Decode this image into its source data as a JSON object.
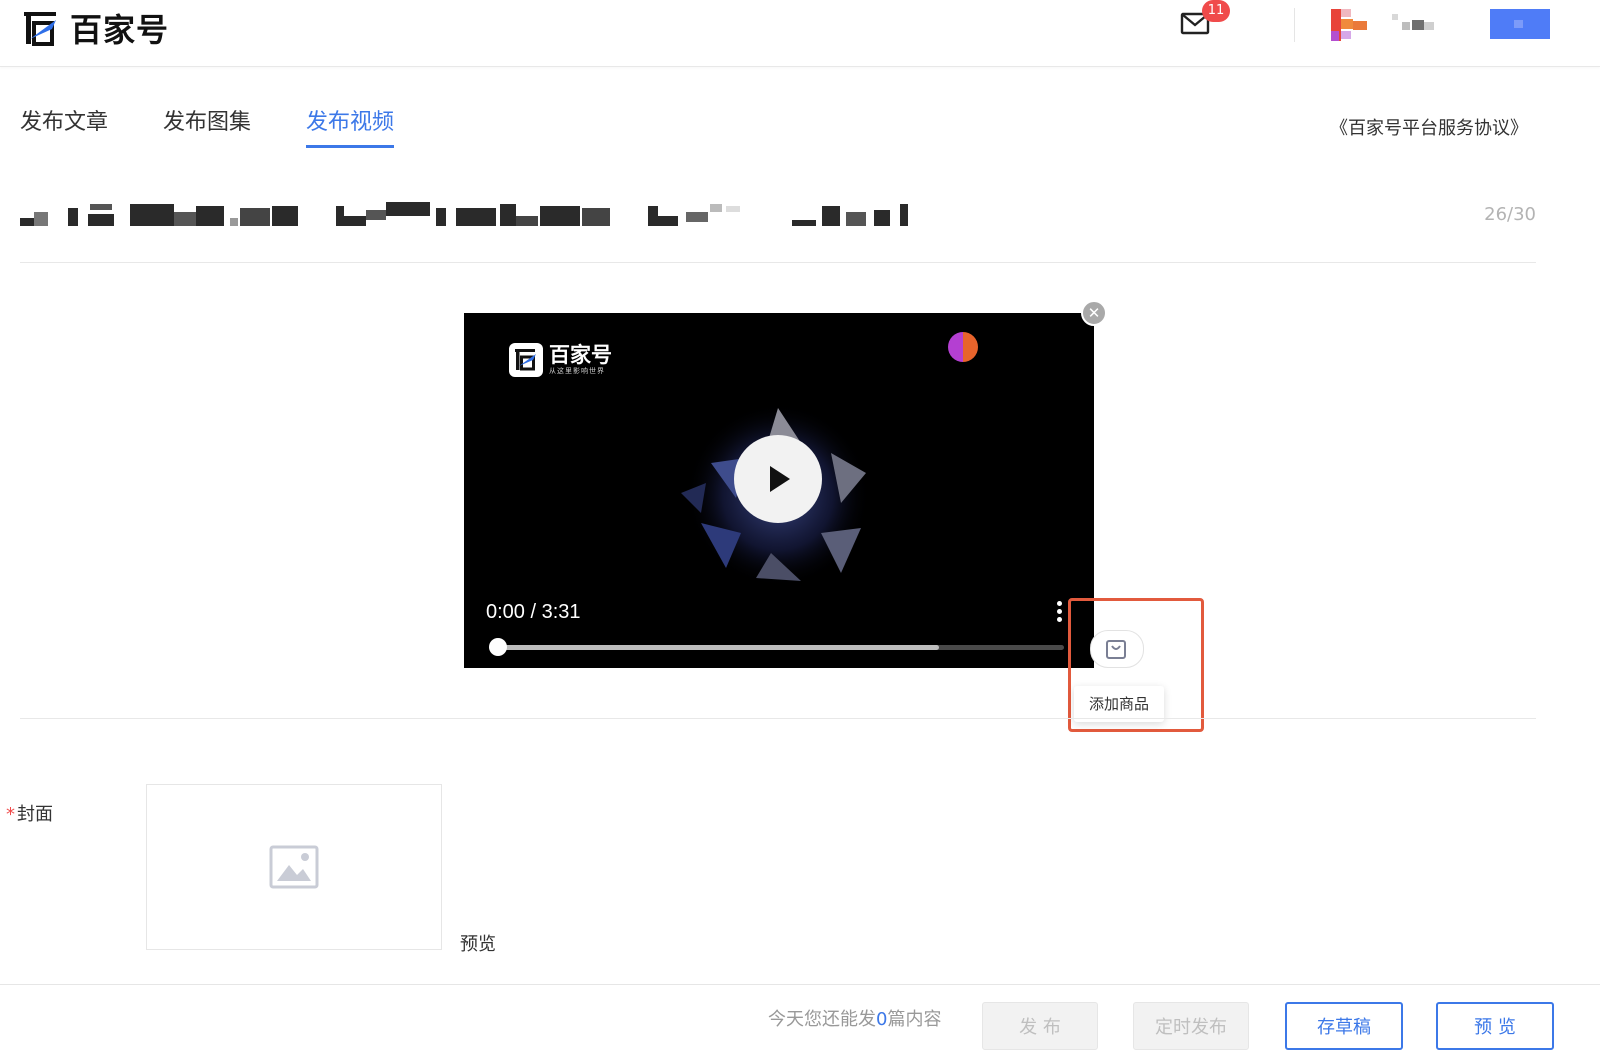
{
  "header": {
    "logo_text": "百家号",
    "mail_badge": "11"
  },
  "tabs": [
    {
      "label": "发布文章",
      "active": false
    },
    {
      "label": "发布图集",
      "active": false
    },
    {
      "label": "发布视频",
      "active": true
    }
  ],
  "agreement_link": "《百家号平台服务协议》",
  "title_field": {
    "count": "26/30"
  },
  "video": {
    "overlay_logo_text": "百家号",
    "overlay_logo_sub": "从这里影响世界",
    "timecode": "0:00 / 3:31",
    "buffered_fraction": 0.78,
    "played_fraction": 0.0
  },
  "add_goods": {
    "tooltip": "添加商品"
  },
  "cover": {
    "required_mark": "*",
    "label": "封面",
    "preview_label": "预览"
  },
  "footer": {
    "quota_prefix": "今天您还能发",
    "quota_count": "0",
    "quota_suffix": "篇内容",
    "publish_label": "发 布",
    "scheduled_label": "定时发布",
    "draft_label": "存草稿",
    "preview_label": "预 览"
  },
  "colors": {
    "accent": "#3c78e8",
    "badge": "#f04b4b",
    "highlight": "#e25a3d"
  }
}
